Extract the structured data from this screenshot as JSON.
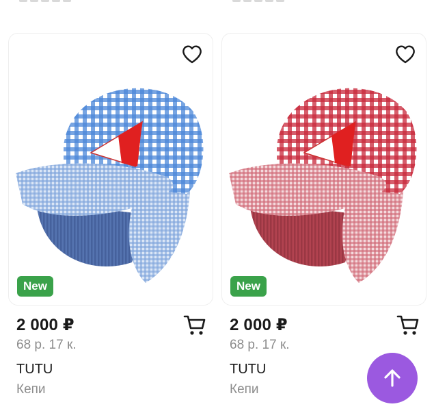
{
  "colors": {
    "badge_bg": "#3aa24a",
    "accent": "#9b59e0",
    "price_text": "#1a1a1a",
    "muted_text": "#8c8c8c"
  },
  "products": [
    {
      "price": "2 000 ₽",
      "size": "68 р. 17 к.",
      "brand": "TUTU",
      "category": "Кепи",
      "badge": "New",
      "image_desc": "blue gingham cap with sailboat",
      "icons": {
        "favorite": "heart-outline-icon",
        "cart": "cart-icon"
      }
    },
    {
      "price": "2 000 ₽",
      "size": "68 р. 17 к.",
      "brand": "TUTU",
      "category": "Кепи",
      "badge": "New",
      "image_desc": "red gingham cap with sailboat",
      "icons": {
        "favorite": "heart-outline-icon",
        "cart": "cart-icon"
      }
    }
  ],
  "scroll_top_icon": "arrow-up-icon"
}
